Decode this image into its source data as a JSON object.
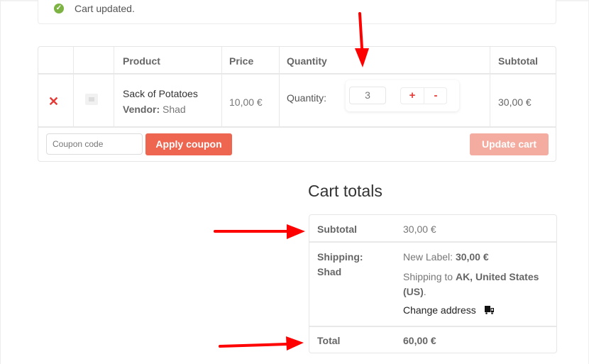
{
  "notice": {
    "icon": "check-circle-icon",
    "message": "Cart updated."
  },
  "cart": {
    "headers": [
      "",
      "",
      "Product",
      "Price",
      "Quantity",
      "Subtotal"
    ],
    "items": [
      {
        "remove_icon": "remove-x-icon",
        "thumbnail_icon": "image-placeholder-icon",
        "name": "Sack of Potatoes",
        "vendor_label": "Vendor:",
        "vendor": "Shad",
        "price": "10,00 €",
        "quantity_label": "Quantity:",
        "quantity": "3",
        "plus_label": "+",
        "minus_label": "-",
        "subtotal": "30,00 €"
      }
    ],
    "coupon_placeholder": "Coupon code",
    "apply_coupon_label": "Apply coupon",
    "update_cart_label": "Update cart"
  },
  "totals": {
    "title": "Cart totals",
    "subtotal_label": "Subtotal",
    "subtotal_value": "30,00 €",
    "shipping_label_1": "Shipping:",
    "shipping_label_2": "Shad",
    "shipping_method_label": "New Label:",
    "shipping_method_price": "30,00 €",
    "shipping_to_prefix": "Shipping to",
    "shipping_to_dest_1": "AK, United States",
    "shipping_to_dest_2": "(US)",
    "shipping_to_suffix": ".",
    "change_address_label": "Change address",
    "change_address_icon": "truck-icon",
    "total_label": "Total",
    "total_value": "60,00 €"
  },
  "annotations": {
    "arrow_color": "#ff0000",
    "count": 3
  }
}
